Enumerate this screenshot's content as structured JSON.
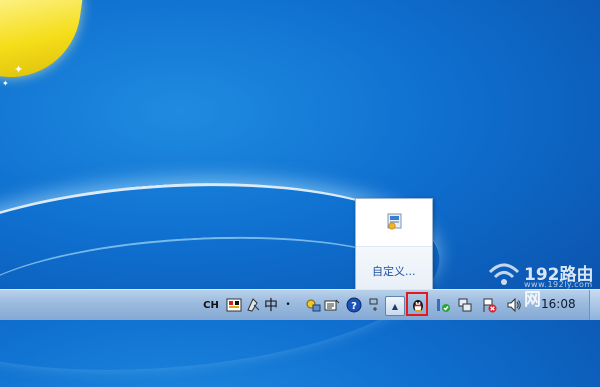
{
  "desktop": {
    "wallpaper_colors": [
      "#1f8be0",
      "#0a4fa8"
    ],
    "logo_color": "#f5de1a"
  },
  "overflow_popup": {
    "icon": "app-tile-icon",
    "customize_label": "自定义..."
  },
  "taskbar": {
    "language_indicator": "CH",
    "ime_label": "中",
    "ime_punct": "•",
    "tray_icons": [
      "input-method-icon",
      "ime-brush-icon",
      "ime-char-icon",
      "ime-settings-icon",
      "ime-keyboard-icon",
      "help-icon"
    ],
    "show_hidden_icons": "chevron-up-icon",
    "highlighted_icon": "qq-penguin-icon",
    "system_icons": [
      "security-shield-icon",
      "network-icon",
      "action-center-flag-icon",
      "volume-icon"
    ],
    "highlight_color": "#e6191f",
    "clock": "16:08"
  },
  "watermark": {
    "text": "192路由网",
    "subtext": "www.192ly.com"
  }
}
